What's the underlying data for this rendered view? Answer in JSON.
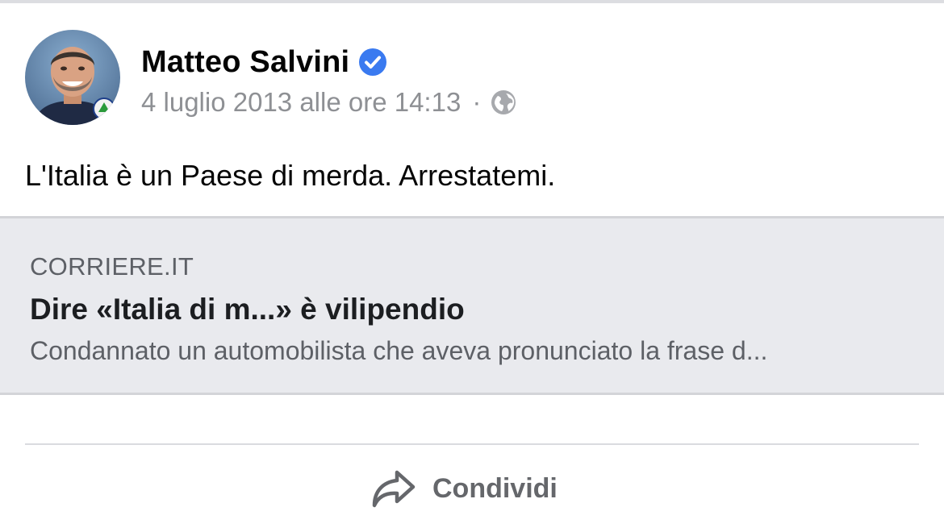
{
  "post": {
    "author": "Matteo Salvini",
    "verified_icon": "verified-badge-icon",
    "timestamp": "4 luglio 2013 alle ore 14:13",
    "separator": "·",
    "audience_icon": "globe-icon",
    "text": "L'Italia è un Paese di merda. Arrestatemi."
  },
  "link_preview": {
    "domain": "CORRIERE.IT",
    "title": "Dire «Italia di m...» è vilipendio",
    "description": "Condannato un automobilista che aveva pronunciato la frase d..."
  },
  "actions": {
    "share_label": "Condividi",
    "share_icon": "share-arrow-icon"
  },
  "colors": {
    "verified_blue": "#3a7af0",
    "meta_gray": "#8e9094",
    "card_background": "#e9eaee",
    "action_gray": "#65676b"
  }
}
